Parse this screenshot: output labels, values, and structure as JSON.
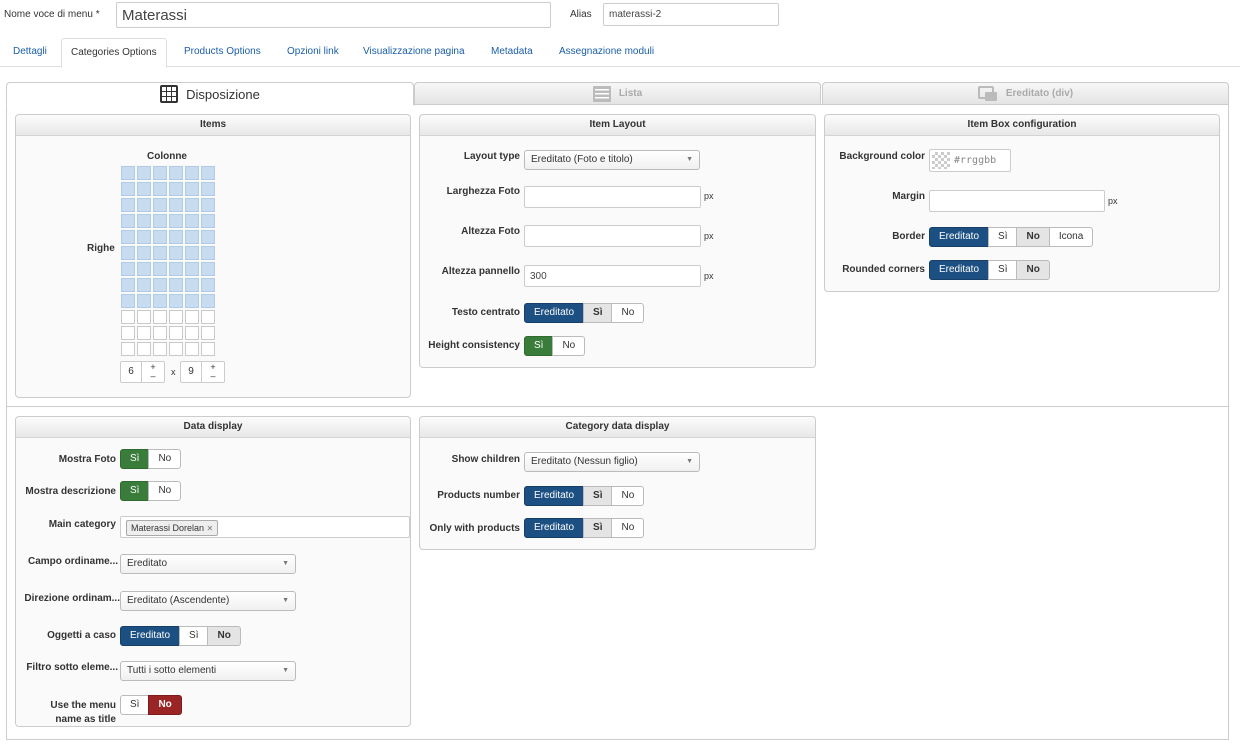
{
  "header": {
    "menu_name_label": "Nome voce di menu *",
    "menu_name_value": "Materassi",
    "alias_label": "Alias",
    "alias_value": "materassi-2"
  },
  "tabs": [
    "Dettagli",
    "Categories Options",
    "Products Options",
    "Opzioni link",
    "Visualizzazione pagina",
    "Metadata",
    "Assegnazione moduli"
  ],
  "layout_tabs": [
    "Disposizione",
    "Lista",
    "Ereditato (div)"
  ],
  "items_panel": {
    "title": "Items",
    "columns_label": "Colonne",
    "rows_label": "Righe",
    "cols": 6,
    "rows": 12,
    "filled_rows": 9,
    "cols_value": "6",
    "rows_value": "9",
    "times": "x",
    "plus": "+",
    "minus": "–"
  },
  "item_layout": {
    "title": "Item Layout",
    "layout_type_label": "Layout type",
    "layout_type_value": "Ereditato (Foto e titolo)",
    "width_label": "Larghezza Foto",
    "height_label": "Altezza Foto",
    "panel_height_label": "Altezza pannello",
    "panel_height_value": "300",
    "px": "px",
    "centered_text_label": "Testo centrato",
    "height_consistency_label": "Height consistency"
  },
  "item_box": {
    "title": "Item Box configuration",
    "bg_color_label": "Background color",
    "bg_color_placeholder": "#rrggbb",
    "margin_label": "Margin",
    "border_label": "Border",
    "rounded_label": "Rounded corners",
    "icona": "Icona"
  },
  "opts": {
    "ereditato": "Ereditato",
    "si": "Sì",
    "no": "No"
  },
  "data_display": {
    "title": "Data display",
    "show_photo_label": "Mostra Foto",
    "show_desc_label": "Mostra descrizione",
    "main_category_label": "Main category",
    "main_category_tag": "Materassi Dorelan",
    "tag_remove": "✕",
    "sort_field_label": "Campo ordiname...",
    "sort_field_value": "Ereditato",
    "sort_dir_label": "Direzione ordinam...",
    "sort_dir_value": "Ereditato (Ascendente)",
    "random_label": "Oggetti a caso",
    "filter_label": "Filtro sotto eleme...",
    "filter_value": "Tutti i sotto elementi",
    "menu_title_label_1": "Use the menu",
    "menu_title_label_2": "name as title"
  },
  "category_display": {
    "title": "Category data display",
    "show_children_label": "Show children",
    "show_children_value": "Ereditato (Nessun figlio)",
    "products_number_label": "Products number",
    "only_with_products_label": "Only with products"
  },
  "colors": {
    "blue": "#1c4f82",
    "green": "#3a7d3a",
    "red": "#9b2424",
    "link": "#1a5ea8",
    "cell": "#c7dcf1"
  }
}
